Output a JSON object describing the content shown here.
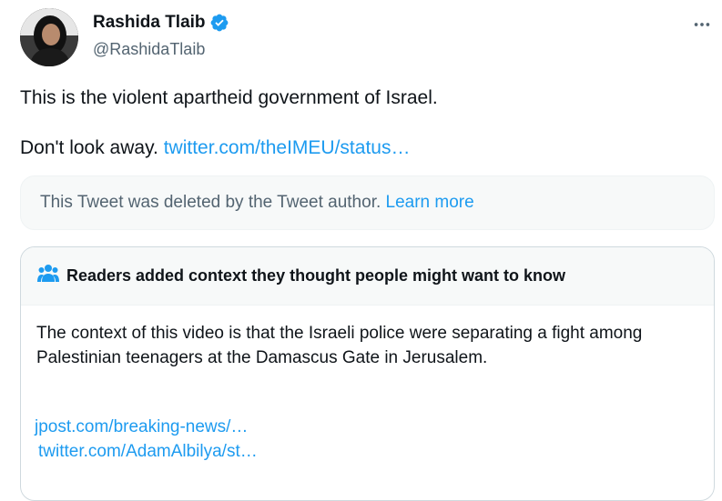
{
  "author": {
    "display_name": "Rashida Tlaib",
    "handle": "@RashidaTlaib",
    "verified_color": "#1d9bf0"
  },
  "tweet": {
    "line1": "This is the violent apartheid government of Israel.",
    "line2_text": "Don't look away.",
    "line2_link": "twitter.com/theIMEU/status…"
  },
  "deleted_notice": {
    "text": "This Tweet was deleted by the Tweet author.",
    "link": "Learn more"
  },
  "community_note": {
    "header": "Readers added context they thought people might want to know",
    "body": "The context of this video is that the Israeli police were separating a fight among Palestinian teenagers at the Damascus Gate in Jerusalem.",
    "links": [
      "jpost.com/breaking-news/…",
      "twitter.com/AdamAlbilya/st…"
    ]
  },
  "colors": {
    "link": "#1d9bf0",
    "secondary_text": "#536471",
    "primary_text": "#0f1419"
  },
  "icons": {
    "verified": "verified-badge-icon",
    "more": "more-options-icon",
    "readers": "readers-people-icon"
  }
}
